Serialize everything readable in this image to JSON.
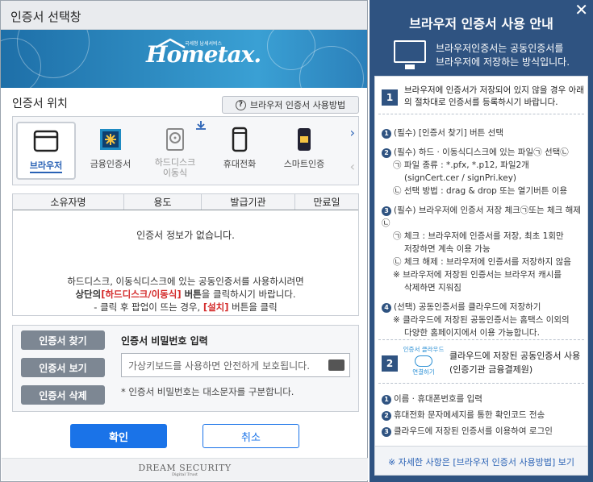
{
  "dialog": {
    "title": "인증서 선택창"
  },
  "banner": {
    "logo_small": "국세청 납세서비스",
    "logo": "Hometax."
  },
  "location": {
    "label": "인증서 위치",
    "help_button": "브라우저 인증서 사용방법"
  },
  "storage": [
    {
      "label": "브라우저",
      "icon": "browser-icon",
      "selected": true
    },
    {
      "label": "금융인증서",
      "icon": "financial-cert-icon"
    },
    {
      "label": "하드디스크\n이동식",
      "icon": "hard-disk-icon",
      "disabled": true
    },
    {
      "label": "휴대전화",
      "icon": "phone-icon"
    },
    {
      "label": "스마트인증",
      "icon": "smart-cert-icon"
    }
  ],
  "table": {
    "headers": [
      "소유자명",
      "용도",
      "발급기관",
      "만료일"
    ],
    "empty": "인증서 정보가 없습니다.",
    "guide1": "하드디스크, 이동식디스크에 있는 공동인증서를 사용하시려면",
    "guide2a": "상단의",
    "guide2b": "[하드디스크/이동식]",
    "guide2c": " 버튼",
    "guide2d": "을 클릭하시기 바랍니다.",
    "guide3a": "- 클릭 후 팝업이 뜨는 경우, ",
    "guide3b": "[설치]",
    "guide3c": " 버튼을 클릭"
  },
  "side_buttons": [
    "인증서 찾기",
    "인증서 보기",
    "인증서 삭제"
  ],
  "password": {
    "label": "인증서 비밀번호 입력",
    "placeholder": "가상키보드를 사용하면 안전하게 보호됩니다.",
    "note": "* 인증서 비밀번호는 대소문자를 구분합니다."
  },
  "actions": {
    "ok": "확인",
    "cancel": "취소"
  },
  "footer": {
    "brand": "DREAM SECURITY",
    "tag": "Digital Trust"
  },
  "guide_panel": {
    "title": "브라우저 인증서 사용 안내",
    "sub1": "브라우저인증서는 공동인증서를",
    "sub2": "브라우저에 저장하는 방식입니다.",
    "s1_num": "1",
    "s1_head": "브라우저에 인증서가 저장되어 있지 않을 경우 아래의 절차대로 인증서를 등록하시기 바랍니다.",
    "step1": "(필수) [인증서 찾기] 버튼 선택",
    "step2": "(필수) 하드 · 이동식디스크에 있는 파일㉠ 선택㉡",
    "step2a": "㉠ 파일 종류 : *.pfx, *.p12, 파일2개",
    "step2b": "(signCert.cer / signPri.key)",
    "step2c": "㉡ 선택 방법 : drag & drop 또는 열기버튼 이용",
    "step3": "(필수) 브라우저에 인증서 저장 체크㉠또는 체크 해제㉡",
    "step3a": "㉠ 체크 : 브라우저에 인증서를 저장, 최초 1회만",
    "step3b": "저장하면 계속 이용 가능",
    "step3c": "㉡ 체크 해제 : 브라우저에 인증서를 저장하지 않음",
    "step3d": "※ 브라우저에 저장된 인증서는 브라우저 캐시를",
    "step3e": "삭제하면 지워짐",
    "step4": "(선택) 공동인증서를 클라우드에 저장하기",
    "step4a": "※ 클라우드에 저장된 공동인증서는 홈택스 이외의",
    "step4b": "다양한 홈페이지에서 이용 가능합니다.",
    "s2_num": "2",
    "cloud_top": "인증서 클라우드",
    "cloud_bottom": "연결하기",
    "s2_head": "클라우드에 저장된 공동인증서 사용 (인증기관 금융결제원)",
    "c1": "이름 · 휴대폰번호를 입력",
    "c2": "휴대전화 문자메세지를 통한 확인코드 전송",
    "c3": "클라우드에 저장된 인증서를 이용하여 로그인",
    "more": "※ 자세한 사항은 [브라우저 인증서 사용방법] 보기"
  }
}
